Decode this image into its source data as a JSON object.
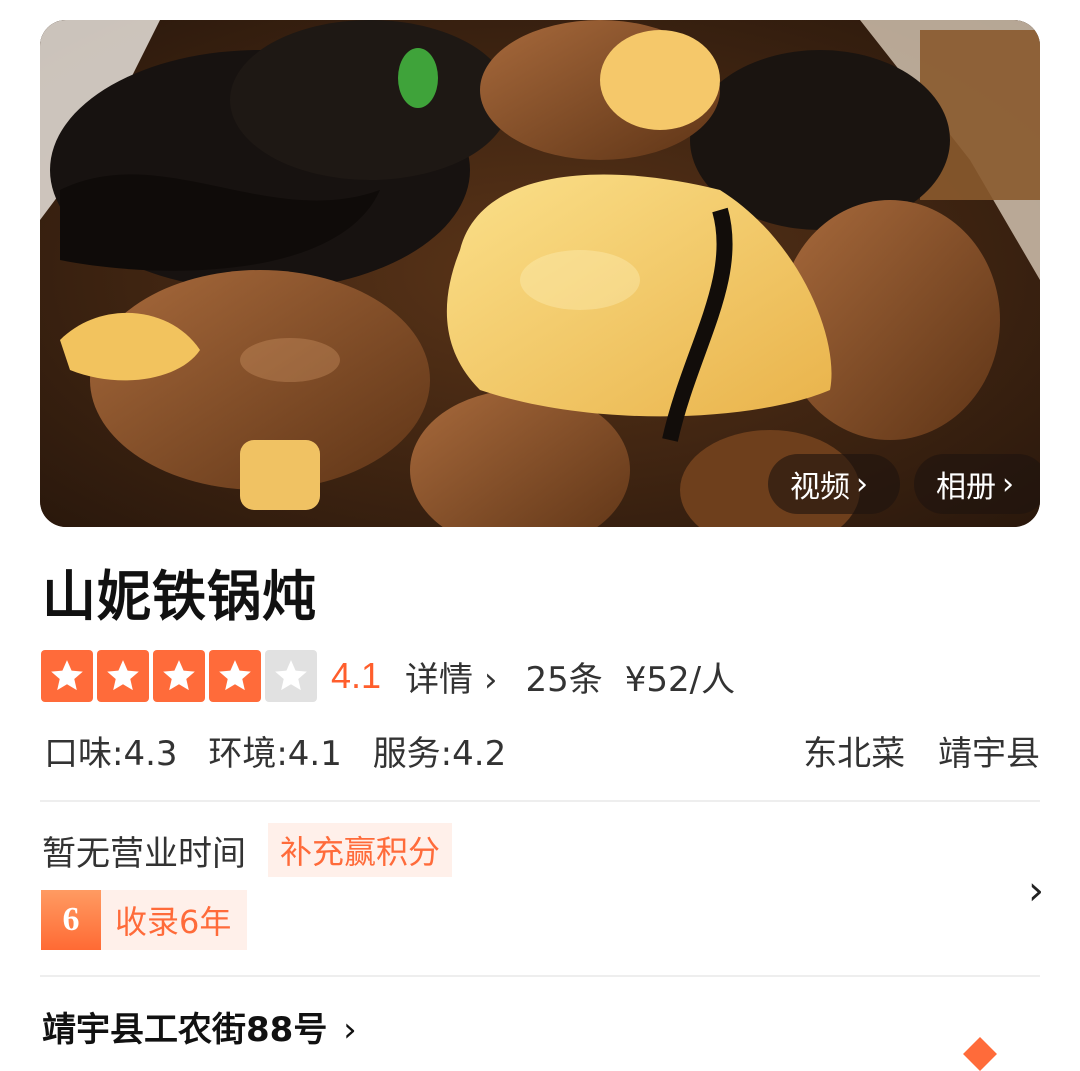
{
  "hero": {
    "video_label": "视频",
    "album_label": "相册",
    "chevron": "›"
  },
  "shop": {
    "name": "山妮铁锅炖",
    "rating": {
      "stars_filled": 4,
      "stars_total": 5,
      "score": "4.1",
      "details_label": "详情",
      "reviews": "25条",
      "price": "¥52/人"
    },
    "sub_scores": [
      "口味:4.3",
      "环境:4.1",
      "服务:4.2"
    ],
    "cuisine": "东北菜",
    "area": "靖宇县"
  },
  "hours": {
    "text": "暂无营业时间",
    "points_tag": "补充赢积分",
    "badge_number": "6",
    "badge_text": "收录6年"
  },
  "address": {
    "text": "靖宇县工农街88号"
  },
  "colors": {
    "accent": "#ff6b3a",
    "star_off": "#e1e1e1",
    "tag_bg": "#fff0ea"
  },
  "icons": {
    "star": "star-icon",
    "chevron": "chevron-right-icon"
  }
}
